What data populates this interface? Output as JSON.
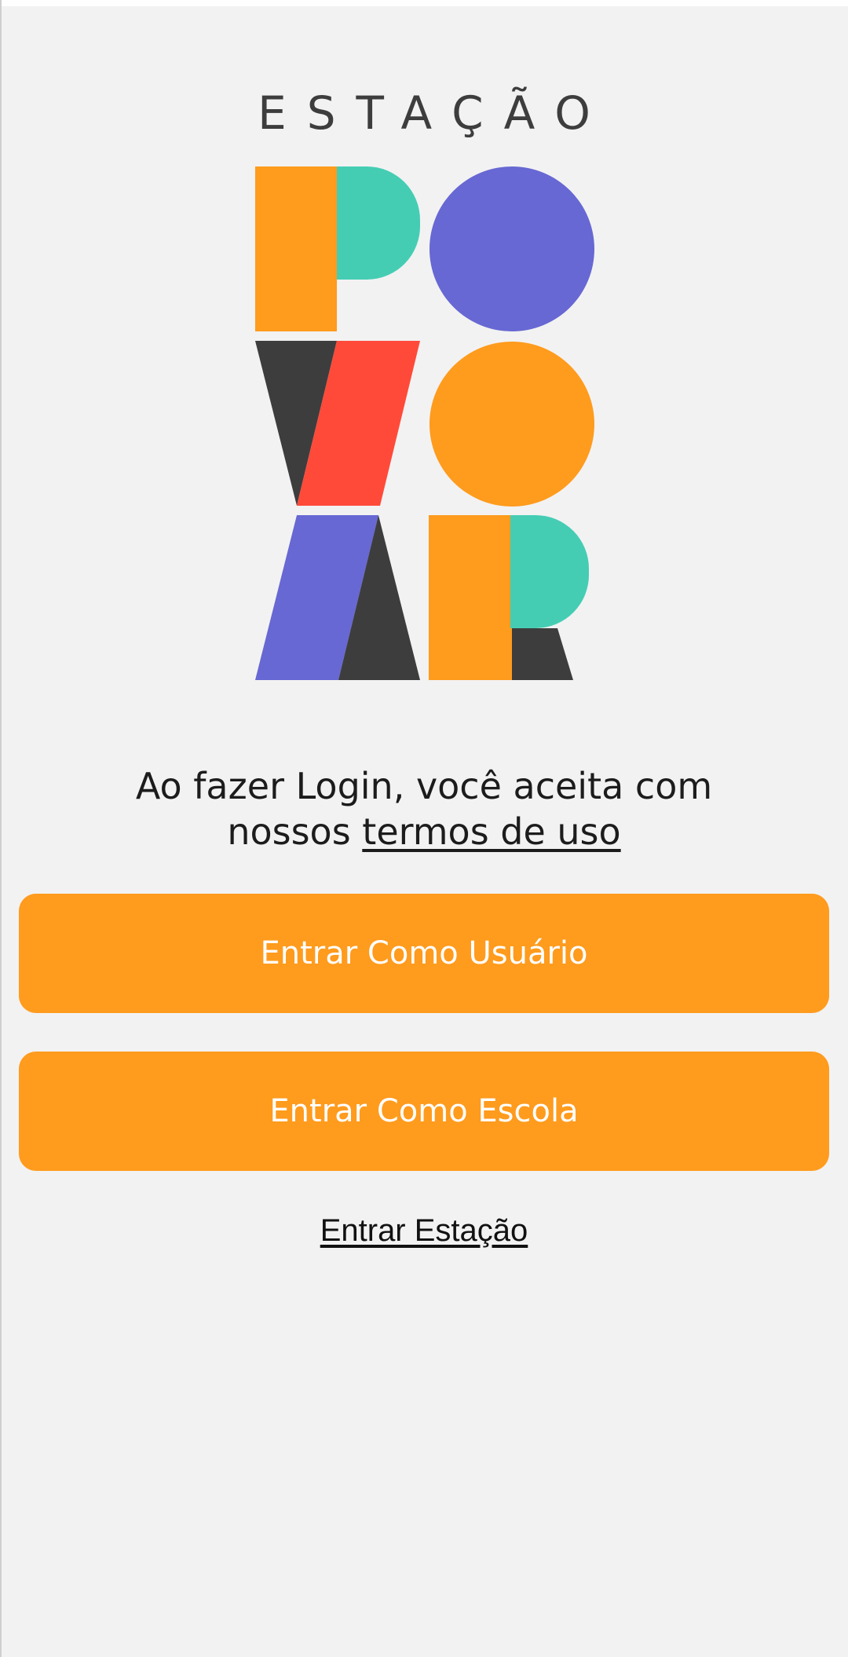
{
  "brand": {
    "title": "ESTAÇÃO"
  },
  "colors": {
    "background": "#f2f2f2",
    "orange": "#ff9b1d",
    "teal": "#45cdb4",
    "purple": "#6768d3",
    "red": "#ff4a3a",
    "dark": "#3d3d3d"
  },
  "terms": {
    "prefix_line1": "Ao fazer Login, você aceita com",
    "prefix_line2": "nossos ",
    "link_label": "termos de uso"
  },
  "actions": {
    "user_login_label": "Entrar Como Usuário",
    "school_login_label": "Entrar Como Escola",
    "station_link_label": "Entrar Estação"
  }
}
